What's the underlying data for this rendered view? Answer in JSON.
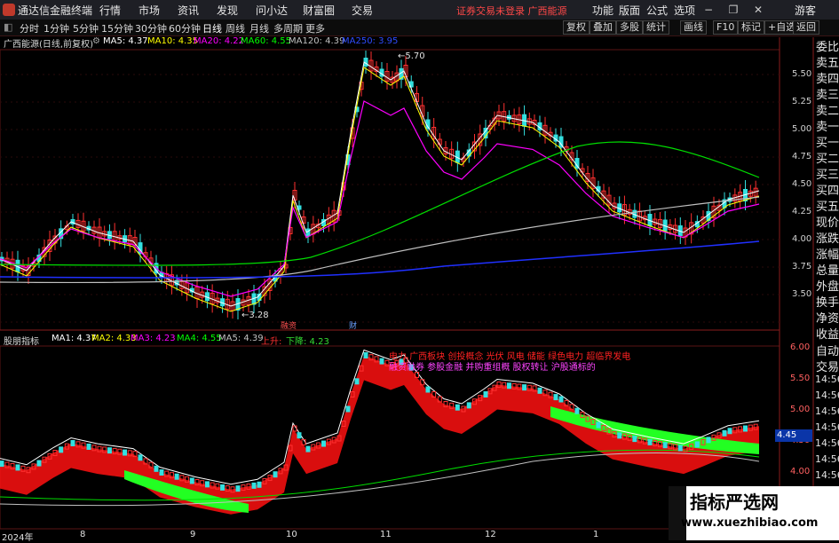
{
  "app": {
    "title": "通达信金融终端"
  },
  "menu": [
    "行情",
    "市场",
    "资讯",
    "发现",
    "问小达",
    "财富圈",
    "交易"
  ],
  "login_status": "证券交易未登录  广西能源",
  "right_menu": [
    "功能",
    "版面",
    "公式",
    "选项"
  ],
  "guest": "游客",
  "periods": [
    "分时",
    "1分钟",
    "5分钟",
    "15分钟",
    "30分钟",
    "60分钟",
    "日线",
    "周线",
    "月线",
    "多周期",
    "更多"
  ],
  "active_period": "日线",
  "tools": [
    "复权",
    "叠加",
    "多股",
    "统计",
    "画线",
    "F10",
    "标记",
    "+自选",
    "返回"
  ],
  "main_chart": {
    "label": "广西能源(日线,前复权)",
    "ma": [
      {
        "name": "MA5",
        "value": "4.37",
        "color": "#ffffff"
      },
      {
        "name": "MA10",
        "value": "4.35",
        "color": "#ffff00"
      },
      {
        "name": "MA20",
        "value": "4.22",
        "color": "#ff00ff"
      },
      {
        "name": "MA60",
        "value": "4.55",
        "color": "#00ff00"
      },
      {
        "name": "MA120",
        "value": "4.39",
        "color": "#c0c0c0"
      },
      {
        "name": "MA250",
        "value": "3.95",
        "color": "#2f4cff"
      }
    ],
    "yaxis": [
      "5.50",
      "5.25",
      "5.00",
      "4.75",
      "4.50",
      "4.25",
      "4.00",
      "3.75",
      "3.50"
    ],
    "high_label": "5.70",
    "low_label": "3.28",
    "flags": [
      "融资",
      "财"
    ]
  },
  "indicator": {
    "label": "股朋指标",
    "ma": [
      {
        "name": "MA1",
        "value": "4.37",
        "color": "#ffffff"
      },
      {
        "name": "MA2",
        "value": "4.33",
        "color": "#ffff00"
      },
      {
        "name": "MA3",
        "value": "4.23",
        "color": "#ff00ff"
      },
      {
        "name": "MA4",
        "value": "4.55",
        "color": "#00ff00"
      },
      {
        "name": "MA5",
        "value": "4.39",
        "color": "#c0c0c0"
      }
    ],
    "up_label": "上升:",
    "down_label": "下降: 4.23",
    "yaxis": [
      "6.00",
      "5.50",
      "5.00",
      "4.50",
      "4.00"
    ],
    "current_value": "4.45",
    "concept_line1": "电力   广西板块  创投概念 光伏 风电 储能 绿色电力 超临界发电",
    "concept_line2": "融资融券 参股金融 并购重组概 股权转让 沪股通标的"
  },
  "sidebar": [
    "委比",
    "卖五",
    "卖四",
    "卖三",
    "卖二",
    "卖一",
    "买一",
    "买二",
    "买三",
    "买四",
    "买五",
    "现价",
    "涨跌",
    "涨幅",
    "总量",
    "外盘",
    "换手",
    "净资",
    "收益"
  ],
  "sidebar2": [
    "自动",
    "交易"
  ],
  "right_times": [
    "14:56",
    "14:56",
    "14:56",
    "14:56",
    "14:56",
    "14:56",
    "14:56",
    "14:56"
  ],
  "xaxis": [
    "2024年",
    "8",
    "9",
    "10",
    "11",
    "12",
    "1"
  ],
  "watermark": {
    "title": "指标严选网",
    "url": "www.xuezhibiao.com"
  }
}
